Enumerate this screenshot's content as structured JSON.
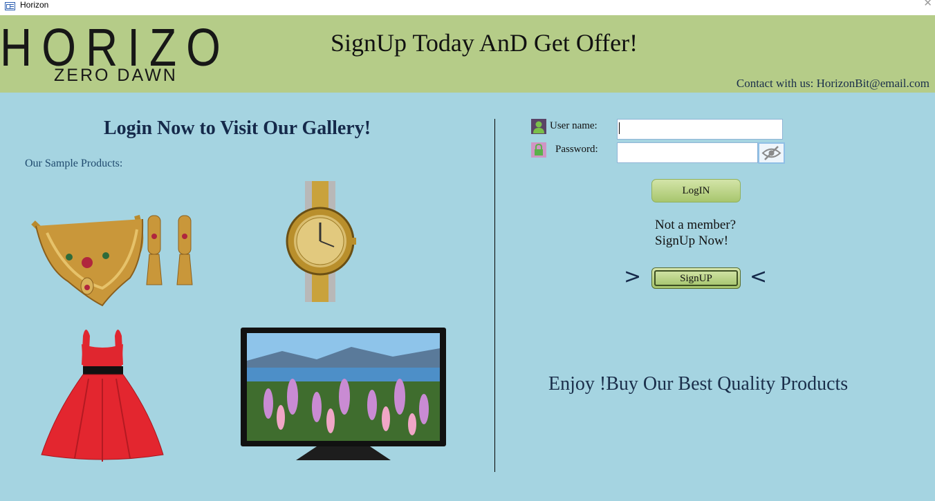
{
  "window": {
    "title": "Horizon",
    "icon": "app-window-icon",
    "close_glyph": "✕"
  },
  "header": {
    "logo": {
      "main": "HORIZON",
      "sub": "ZERO DAWN"
    },
    "promo": "SignUp Today AnD Get Offer!",
    "contact": "Contact with us: HorizonBit@email.com",
    "background": "#b5cc88"
  },
  "gallery": {
    "title": "Login Now to Visit Our Gallery!",
    "sample_label": "Our Sample Products:",
    "products": [
      {
        "name": "necklace-set"
      },
      {
        "name": "wrist-watch"
      },
      {
        "name": "red-dress"
      },
      {
        "name": "flat-screen-tv"
      }
    ]
  },
  "login": {
    "username_label": "User name:",
    "password_label": "Password:",
    "username_value": "",
    "password_value": "",
    "login_button": "LogIN",
    "not_member_line1": "Not a member?",
    "not_member_line2": "SignUp Now!",
    "signup_button": "SignUP",
    "arrow_left": ">",
    "arrow_right": "<"
  },
  "footer": {
    "tagline": "Enjoy !Buy Our Best Quality Products"
  },
  "colors": {
    "background": "#a5d4e1",
    "button": "#b5cc88",
    "text": "#1a2e4a"
  }
}
